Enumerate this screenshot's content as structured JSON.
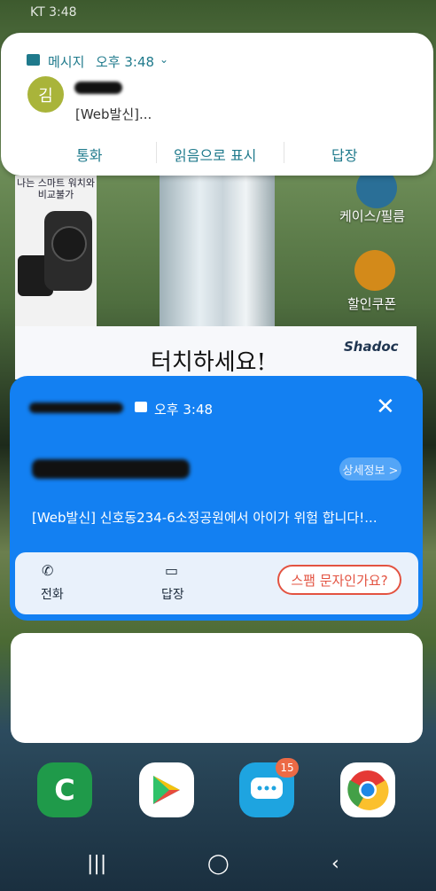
{
  "status_bar": {
    "carrier_time": "KT 3:48"
  },
  "wallpaper_app": {
    "ad_text": "나는 스마트 워치와\n비교불가",
    "banner_text": "터치하세요!",
    "brand": "Shadoc",
    "side_items": [
      {
        "label": "케이스/필름",
        "icon": "case-icon"
      },
      {
        "label": "할인쿠폰",
        "icon": "coupon-icon"
      }
    ]
  },
  "top_notification": {
    "app_name": "메시지",
    "time": "오후 3:48",
    "avatar_letter": "김",
    "message": "[Web발신]...",
    "actions": [
      "통화",
      "읽음으로 표시",
      "답장"
    ]
  },
  "spam_card": {
    "time": "오후 3:48",
    "detail_button": "상세정보 >",
    "message": "[Web발신] 신호동234-6소정공원에서 아이가 위험 합니다!...",
    "actions": {
      "call": "전화",
      "reply": "답장"
    },
    "spam_button": "스팸 문자인가요?"
  },
  "dock": {
    "apps": [
      "phone",
      "play-store",
      "messages",
      "chrome"
    ],
    "messages_badge": "15"
  },
  "colors": {
    "accent": "#1f7a8c",
    "card_blue": "#1380f2",
    "spam_red": "#e35341"
  }
}
